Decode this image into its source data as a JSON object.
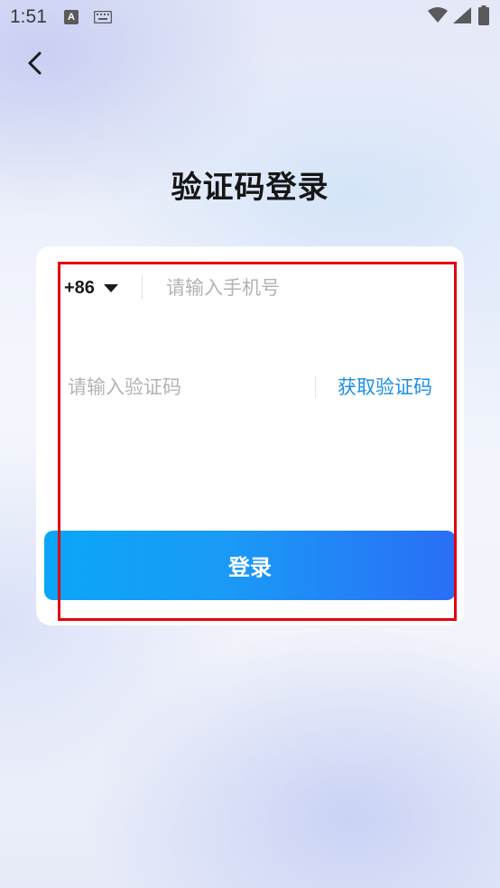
{
  "status_bar": {
    "time": "1:51",
    "notification_icon_letter": "A"
  },
  "header": {
    "title": "验证码登录"
  },
  "form": {
    "country_code": "+86",
    "phone_placeholder": "请输入手机号",
    "code_placeholder": "请输入验证码",
    "get_code_label": "获取验证码",
    "login_label": "登录"
  },
  "colors": {
    "accent": "#1a8fe6",
    "button_start": "#0ba6f7",
    "button_end": "#2a6ef6",
    "highlight": "#e3000f"
  }
}
